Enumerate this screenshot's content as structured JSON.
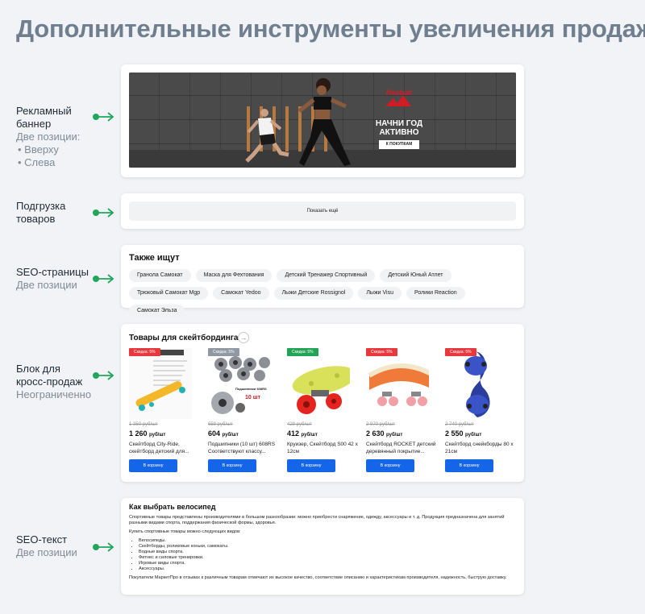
{
  "title": "Дополнительные инструменты увеличения продаж",
  "sections": {
    "banner": {
      "title": "Рекламный\nбаннер",
      "subtitle": "Две позиции:",
      "positions": [
        "• Вверху",
        "• Слева"
      ]
    },
    "loadmore": {
      "title": "Подгрузка\nтоваров"
    },
    "seo_pages": {
      "title": "SEO-страницы",
      "subtitle": "Две позиции"
    },
    "cross": {
      "title": "Блок для\nкросс-продаж",
      "subtitle": "Неограниченно"
    },
    "seo_text": {
      "title": "SEO-текст",
      "subtitle": "Две позиции"
    }
  },
  "banner_ad": {
    "brand": "Reebok",
    "headline": "НАЧНИ ГОД\nАКТИВНО",
    "button": "К ПОКУПКАМ"
  },
  "load_more": {
    "label": "Показать ещё"
  },
  "also_search": {
    "heading": "Также ищут",
    "tags": [
      "Гранола Самокат",
      "Маска для Фехтования",
      "Детский Тренажер Спортивный",
      "Детский Юный Атлет",
      "Трюковый Самокат Mgp",
      "Самокат Yedoo",
      "Лыжи Детские Rossignol",
      "Лыжи Visu",
      "Ролики Reaction",
      "Самокат Эльза"
    ]
  },
  "goods": {
    "heading": "Товары для скейтбординга",
    "arrow": "→",
    "products": [
      {
        "badge": "Скидка: 5%",
        "badge_color": "#e8383d",
        "old_price": "1 350 руб/шт",
        "price": "1 260",
        "unit": "руб/шт",
        "name": "Скейтборд City-Ride, скейтборд детский для...",
        "button": "В корзину",
        "image": "skateboard-yellow"
      },
      {
        "badge": "Скидка: 5%",
        "badge_color": "#8f98a3",
        "old_price": "659 руб/шт",
        "price": "604",
        "unit": "руб/шт",
        "name": "Подшипники (10 шт) 608RS Соответствуют классу...",
        "button": "В корзину",
        "image": "bearings"
      },
      {
        "badge": "Скидка: 5%",
        "badge_color": "#21a454",
        "old_price": "429 руб/шт",
        "price": "412",
        "unit": "руб/шт",
        "name": "Круизер, Скейтборд S00 42 x 12см",
        "button": "В корзину",
        "image": "cruiser"
      },
      {
        "badge": "Скидка: 5%",
        "badge_color": "#e8383d",
        "old_price": "2 970 руб/шт",
        "price": "2 630",
        "unit": "руб/шт",
        "name": "Скейтборд ROCKET детский деревянный покрытие...",
        "button": "В корзину",
        "image": "skateboard-rocket"
      },
      {
        "badge": "Скидка: 5%",
        "badge_color": "#e8383d",
        "old_price": "2 740 руб/шт",
        "price": "2 550",
        "unit": "руб/шт",
        "name": "Скейтборд снейкборды 80 x 21см",
        "button": "В корзину",
        "image": "snakeboard"
      }
    ],
    "bearings_caption": "Подшипники 608RS",
    "bearings_count": "10 шт"
  },
  "seo_article": {
    "heading": "Как выбрать велосипед",
    "intro": "Спортивные товары представлены производителями в большом разнообразии: можно приобрести снаряжение, одежду, аксессуары и т. д. Продукция предназначена для занятий разными видами спорта, поддержания физической формы, здоровья.",
    "list_intro": "Купить спортивные товары можно следующих видов:",
    "items": [
      "Велосипеды.",
      "Скейтборды, роликовые коньки, самокаты.",
      "Водные виды спорта.",
      "Фитнес и силовые тренировки.",
      "Игровые виды спорта.",
      "Аксессуары."
    ],
    "outro": "Покупатели МаркетПро в отзывах к различным товарам отмечают их высокое качество, соответствие описанию и характеристикам производителя, надежность, быструю доставку."
  }
}
